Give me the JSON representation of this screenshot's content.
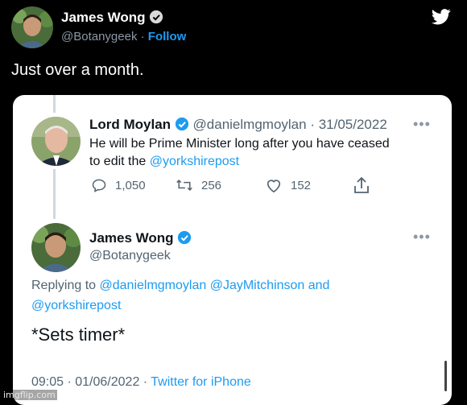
{
  "tweet": {
    "author": {
      "name": "James Wong",
      "handle": "@Botanygeek",
      "follow": "Follow",
      "sep": "·"
    },
    "text": "Just over a month.",
    "logo_icon": "twitter-bird-icon"
  },
  "quoted": {
    "name": "Lord Moylan",
    "handle": "@danielmgmoylan",
    "date": "· 31/05/2022",
    "text_line1": "He will be Prime Minister long after you have ceased",
    "text_line2_prefix": "to edit the ",
    "mention": "@yorkshirepost",
    "actions": {
      "replies": "1,050",
      "retweets": "256",
      "likes": "152"
    }
  },
  "reply": {
    "name": "James Wong",
    "handle": "@Botanygeek",
    "replying_prefix": "Replying to ",
    "replying_mentions": "@danielmgmoylan @JayMitchinson and",
    "replying_line2": "@yorkshirepost",
    "text": "*Sets timer*",
    "meta_time": "09:05 · 01/06/2022 · ",
    "meta_source": "Twitter for iPhone"
  },
  "watermark": "imgflip.com",
  "colors": {
    "accent": "#1d9bf0",
    "background": "#000000",
    "card": "#ffffff"
  }
}
